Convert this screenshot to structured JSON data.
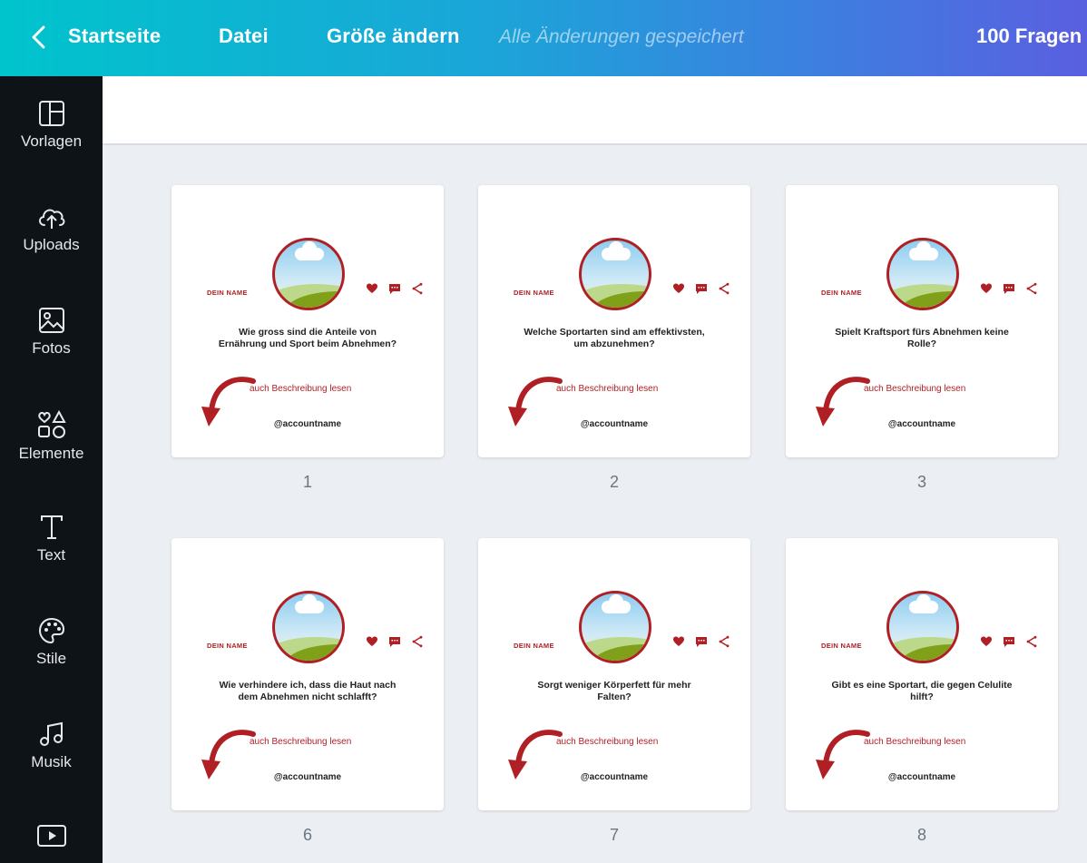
{
  "header": {
    "back_label": "Startseite",
    "file_label": "Datei",
    "resize_label": "Größe ändern",
    "save_status": "Alle Änderungen gespeichert",
    "project_title": "100 Fragen"
  },
  "sidebar": {
    "items": [
      {
        "label": "Vorlagen",
        "icon": "layout-icon"
      },
      {
        "label": "Uploads",
        "icon": "upload-cloud-icon"
      },
      {
        "label": "Fotos",
        "icon": "image-icon"
      },
      {
        "label": "Elemente",
        "icon": "shapes-icon"
      },
      {
        "label": "Text",
        "icon": "text-icon"
      },
      {
        "label": "Stile",
        "icon": "palette-icon"
      },
      {
        "label": "Musik",
        "icon": "music-icon"
      },
      {
        "label": "",
        "icon": "video-icon"
      }
    ]
  },
  "pages": [
    {
      "number": "1",
      "name": "DEIN NAME",
      "question_line1": "Wie gross sind die Anteile von",
      "question_line2": "Ernährung und Sport beim Abnehmen?",
      "desc": "auch Beschreibung lesen",
      "account": "@accountname"
    },
    {
      "number": "2",
      "name": "DEIN NAME",
      "question_line1": "Welche Sportarten sind am effektivsten,",
      "question_line2": "um abzunehmen?",
      "desc": "auch Beschreibung lesen",
      "account": "@accountname"
    },
    {
      "number": "3",
      "name": "DEIN NAME",
      "question_line1": "Spielt Kraftsport fürs Abnehmen keine",
      "question_line2": "Rolle?",
      "desc": "auch Beschreibung lesen",
      "account": "@accountname"
    },
    {
      "number": "6",
      "name": "DEIN NAME",
      "question_line1": "Wie verhindere ich, dass die Haut nach",
      "question_line2": "dem Abnehmen nicht schlafft?",
      "desc": "auch Beschreibung lesen",
      "account": "@accountname"
    },
    {
      "number": "7",
      "name": "DEIN NAME",
      "question_line1": "Sorgt weniger Körperfett für mehr",
      "question_line2": "Falten?",
      "desc": "auch Beschreibung lesen",
      "account": "@accountname"
    },
    {
      "number": "8",
      "name": "DEIN NAME",
      "question_line1": "Gibt es eine Sportart, die gegen Celulite",
      "question_line2": "hilft?",
      "desc": "auch Beschreibung lesen",
      "account": "@accountname"
    }
  ],
  "colors": {
    "accent_red": "#b01f24",
    "sidebar_bg": "#0e1318",
    "canvas_bg": "#ebeef2"
  }
}
